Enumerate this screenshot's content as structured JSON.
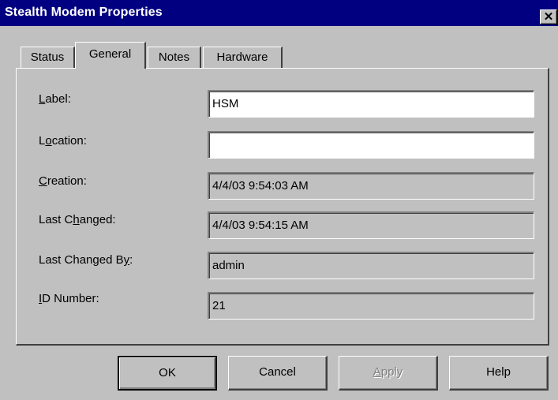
{
  "window": {
    "title": "Stealth Modem Properties",
    "close_glyph": "✕"
  },
  "tabs": [
    {
      "label": "Status",
      "active": false
    },
    {
      "label": "General",
      "active": true
    },
    {
      "label": "Notes",
      "active": false
    },
    {
      "label": "Hardware",
      "active": false
    }
  ],
  "form": {
    "label": {
      "caption_pre": "",
      "caption_key": "L",
      "caption_post": "abel:",
      "value": "HSM"
    },
    "location": {
      "caption_pre": "L",
      "caption_key": "o",
      "caption_post": "cation:",
      "value": ""
    },
    "creation": {
      "caption_pre": "",
      "caption_key": "C",
      "caption_post": "reation:",
      "value": "4/4/03 9:54:03 AM"
    },
    "last_changed": {
      "caption_pre": "Last C",
      "caption_key": "h",
      "caption_post": "anged:",
      "value": "4/4/03 9:54:15 AM"
    },
    "last_changed_by": {
      "caption_pre": "Last Changed B",
      "caption_key": "y",
      "caption_post": ":",
      "value": "admin"
    },
    "id_number": {
      "caption_pre": "",
      "caption_key": "I",
      "caption_post": "D Number:",
      "value": "21"
    }
  },
  "buttons": {
    "ok": "OK",
    "cancel": "Cancel",
    "apply_key": "A",
    "apply_rest": "pply",
    "help": "Help"
  }
}
